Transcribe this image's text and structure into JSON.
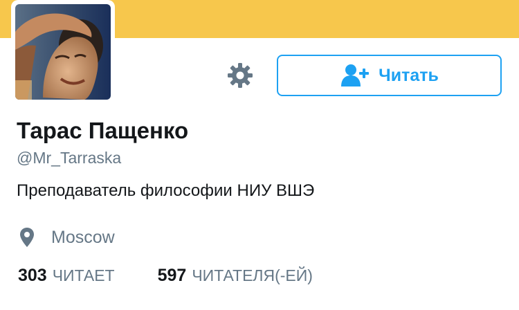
{
  "colors": {
    "banner": "#f7c74c",
    "accent": "#1da1f2",
    "primary_text": "#14171a",
    "secondary_text": "#657786",
    "icon_gray": "#657786"
  },
  "profile": {
    "name": "Тарас Пащенко",
    "handle": "@Mr_Tarraska",
    "bio": "Преподаватель философии НИУ ВШЭ",
    "location": "Moscow"
  },
  "actions": {
    "settings_icon": "gear-icon",
    "follow_icon": "add-user-icon",
    "follow_label": "Читать"
  },
  "stats": {
    "following_count": "303",
    "following_label": "ЧИТАЕТ",
    "followers_count": "597",
    "followers_label": "ЧИТАТЕЛЯ(-ЕЙ)"
  }
}
